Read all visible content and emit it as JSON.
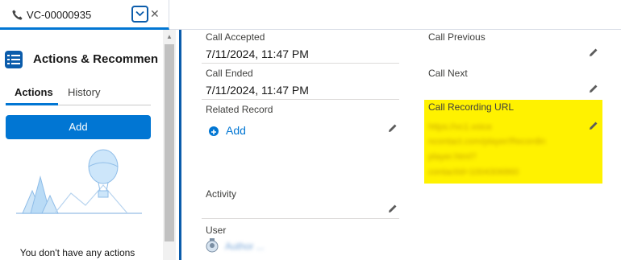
{
  "tab": {
    "title": "VC-00000935",
    "close_glyph": "✕",
    "phone_icon": "phone-icon"
  },
  "panel": {
    "title": "Actions & Recommendations",
    "tabs": [
      "Actions",
      "History"
    ],
    "add_button": "Add",
    "empty_message": "You don't have any actions"
  },
  "fields": {
    "call_accepted": {
      "label": "Call Accepted",
      "value": "7/11/2024, 11:47 PM"
    },
    "call_ended": {
      "label": "Call Ended",
      "value": "7/11/2024, 11:47 PM"
    },
    "related_record": {
      "label": "Related Record",
      "add_label": "Add"
    },
    "activity": {
      "label": "Activity",
      "value": ""
    },
    "user": {
      "label": "User",
      "value": "Author ..."
    },
    "call_previous": {
      "label": "Call Previous",
      "value": ""
    },
    "call_next": {
      "label": "Call Next",
      "value": ""
    },
    "call_recording_url": {
      "label": "Call Recording URL",
      "value_lines": [
        "https://vc1.voice",
        "ncontact.com/player/Recordin",
        "player.html?",
        "contactId=1004306860"
      ]
    }
  },
  "colors": {
    "brand": "#0176d3",
    "highlight": "#fff200"
  }
}
